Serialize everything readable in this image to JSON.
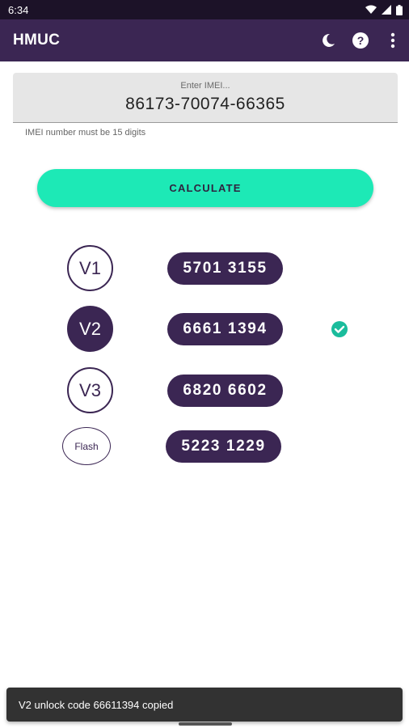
{
  "status_bar": {
    "time": "6:34",
    "icons": [
      "wifi-icon",
      "signal-icon",
      "battery-icon"
    ]
  },
  "app_bar": {
    "title": "HMUC",
    "actions": [
      "moon-icon",
      "help-icon",
      "more-vert-icon"
    ]
  },
  "imei": {
    "label": "Enter IMEI...",
    "value": "86173-70074-66365",
    "helper": "IMEI number must be 15 digits"
  },
  "calculate_label": "CALCULATE",
  "results": [
    {
      "version": "V1",
      "code": "5701  3155",
      "selected": false
    },
    {
      "version": "V2",
      "code": "6661  1394",
      "selected": true
    },
    {
      "version": "V3",
      "code": "6820  6602",
      "selected": false
    },
    {
      "version": "Flash",
      "code": "5223  1229",
      "selected": false
    }
  ],
  "snackbar": "V2 unlock code 66611394 copied",
  "colors": {
    "primary": "#3b2653",
    "accent": "#1de9b6",
    "check": "#1abc9c"
  }
}
